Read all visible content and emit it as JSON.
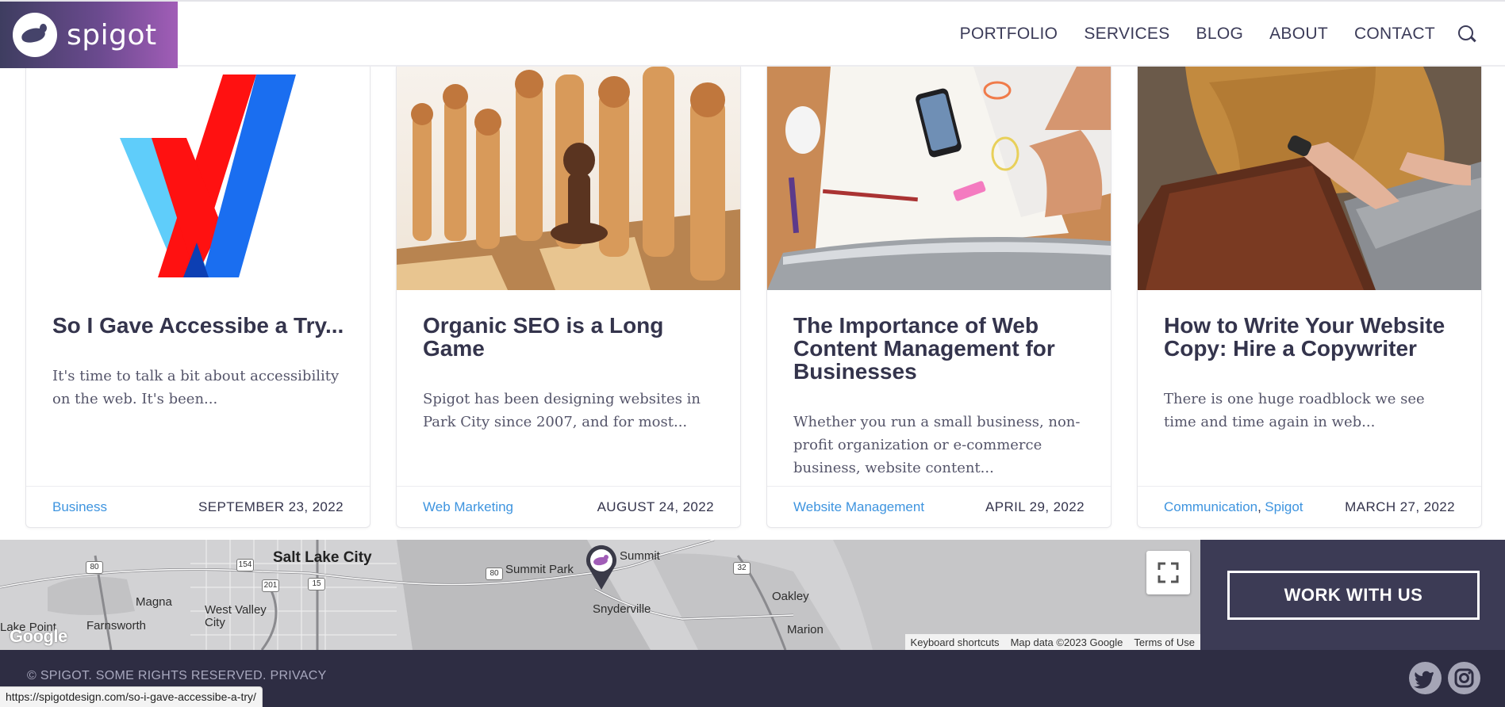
{
  "header": {
    "logo_text": "spigot",
    "nav": [
      "PORTFOLIO",
      "SERVICES",
      "BLOG",
      "ABOUT",
      "CONTACT"
    ],
    "search_icon": "search-icon"
  },
  "posts": [
    {
      "title": "So I Gave Accessibe a Try...",
      "excerpt": "It's time to talk a bit about accessibility on the web. It's been...",
      "category": "Business",
      "category_2": "",
      "date": "SEPTEMBER 23, 2022"
    },
    {
      "title": "Organic SEO is a Long Game",
      "excerpt": "Spigot has been designing websites in Park City since 2007, and for most...",
      "category": "Web Marketing",
      "category_2": "",
      "date": "AUGUST 24, 2022"
    },
    {
      "title": "The Importance of Web Content Management for Businesses",
      "excerpt": "Whether you run a small business, non-profit organization or e-commerce business, website content...",
      "category": "Website Management",
      "category_2": "",
      "date": "APRIL 29, 2022"
    },
    {
      "title": "How to Write Your Website Copy: Hire a Copywriter",
      "excerpt": "There is one huge roadblock we see time and time again in web...",
      "category": "Communication",
      "category_2": "Spigot",
      "date": "MARCH 27, 2022"
    }
  ],
  "map": {
    "places": [
      "Salt Lake City",
      "Summit",
      "Summit Park",
      "Magna",
      "West Valley City",
      "Farnsworth",
      "Snyderville",
      "Oakley",
      "Marion",
      "Lake Point"
    ],
    "roads": [
      "80",
      "154",
      "201",
      "15",
      "80",
      "32"
    ],
    "google_logo": "Google",
    "attribution": [
      "Keyboard shortcuts",
      "Map data ©2023 Google",
      "Terms of Use"
    ]
  },
  "cta": {
    "label": "WORK WITH US"
  },
  "footer": {
    "copyright": "© SPIGOT. SOME RIGHTS RESERVED. PRIVACY",
    "social": [
      "twitter-icon",
      "instagram-icon"
    ]
  },
  "status_bar": {
    "url": "https://spigotdesign.com/so-i-gave-accessibe-a-try/"
  },
  "colors": {
    "accent_blue": "#3e94df",
    "dark_navy": "#3c3b55",
    "footer": "#2e2d43",
    "logo_purple": "#a15db7"
  }
}
